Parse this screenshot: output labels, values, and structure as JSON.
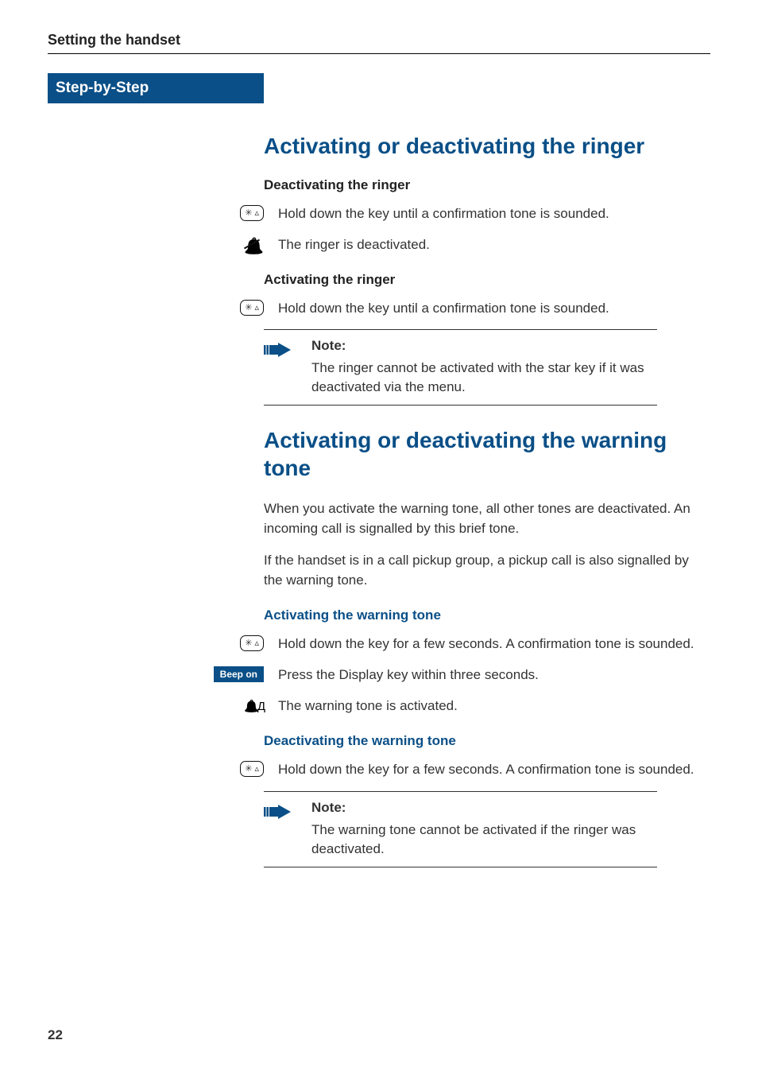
{
  "header": {
    "title": "Setting the handset"
  },
  "sidebar": {
    "tab": "Step-by-Step"
  },
  "section1": {
    "title": "Activating or deactivating the ringer",
    "sub1": "Deactivating the ringer",
    "step1": "Hold down the key until a confirmation tone is sounded.",
    "step2": "The ringer is deactivated.",
    "sub2": "Activating the ringer",
    "step3": "Hold down the key until a confirmation tone is sounded.",
    "note_label": "Note:",
    "note_text": "The ringer cannot be activated with the star key if it was deactivated via the menu."
  },
  "section2": {
    "title": "Activating or deactivating the warning tone",
    "intro1": "When you activate the warning tone, all other tones are deactivated. An incoming call is signalled by this brief tone.",
    "intro2": "If the handset is in a call pickup group, a pickup call is also signalled by the warning tone.",
    "sub1": "Activating the warning tone",
    "step1": "Hold down the key for a few seconds. A confirmation tone is sounded.",
    "beep_label": "Beep on",
    "step2": "Press the Display key within three seconds.",
    "step3": "The warning tone is activated.",
    "sub2": "Deactivating the warning tone",
    "step4": "Hold down the key for a few seconds. A confirmation tone is sounded.",
    "note_label": "Note:",
    "note_text": "The warning tone cannot be activated if the ringer was deactivated."
  },
  "page_number": "22"
}
